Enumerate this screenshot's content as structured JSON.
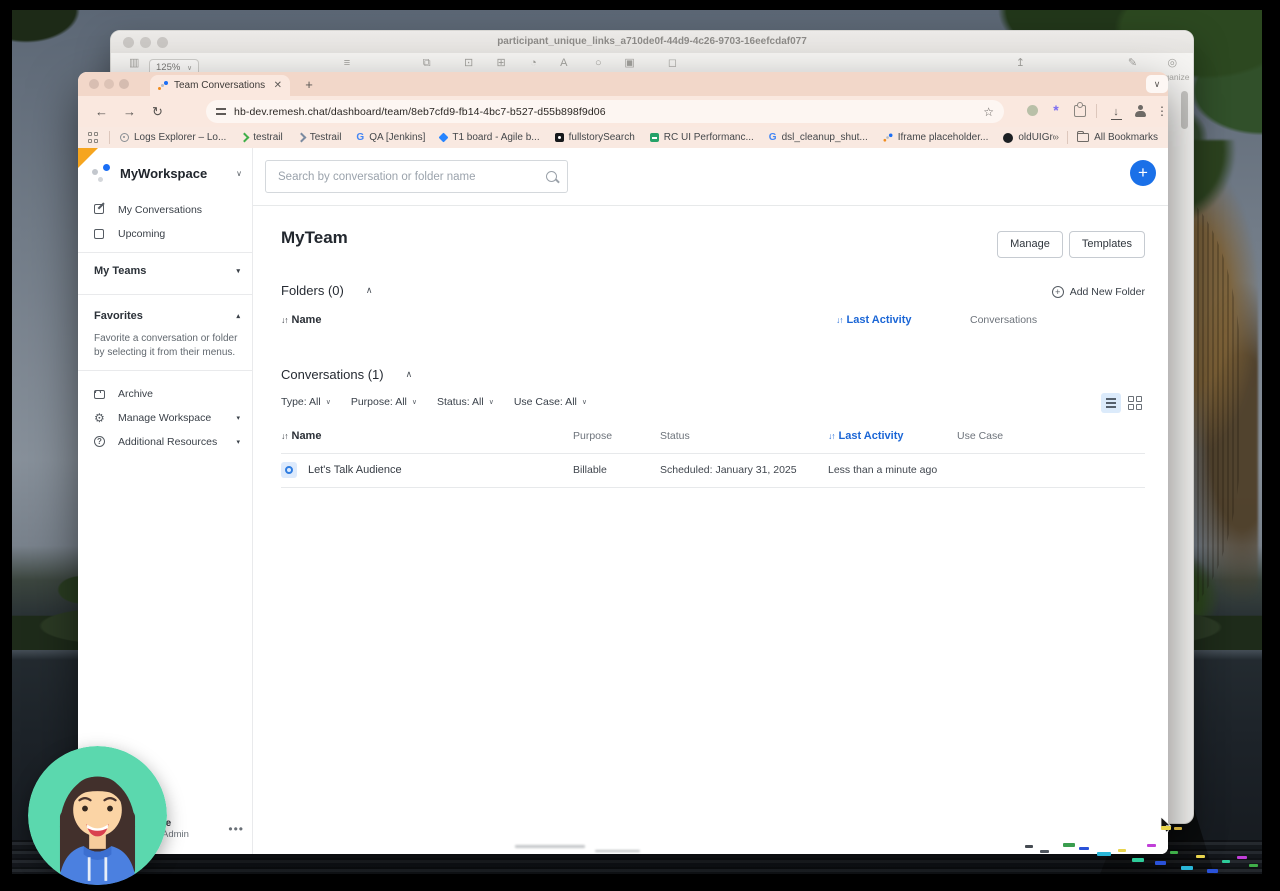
{
  "background_window": {
    "title": "participant_unique_links_a710de0f-44d9-4c26-9703-16eefcdaf077",
    "zoom_value": "125%",
    "toolbar": [
      "View",
      "Zoom",
      "Add Category",
      "Pivot Table",
      "Insert",
      "Table",
      "Chart",
      "Text",
      "Shape",
      "Media",
      "Comment",
      "Share",
      "Format",
      "Organize"
    ]
  },
  "browser": {
    "tab_title": "Team Conversations",
    "url": "hb-dev.remesh.chat/dashboard/team/8eb7cfd9-fb14-4bc7-b527-d55b898f9d06",
    "bookmarks": [
      "Logs Explorer – Lo...",
      "testrail",
      "Testrail",
      "QA [Jenkins]",
      "T1 board - Agile b...",
      "fullstorySearch",
      "RC UI Performanc...",
      "dsl_cleanup_shut...",
      "Iframe placeholder...",
      "oldUIGreen&Black"
    ],
    "all_bookmarks": "All Bookmarks"
  },
  "app": {
    "workspace": "MyWorkspace",
    "nav_my_conversations": "My Conversations",
    "nav_upcoming": "Upcoming",
    "section_my_teams": "My Teams",
    "section_favorites": "Favorites",
    "favorites_hint": "Favorite a conversation or folder by selecting it from their menus.",
    "nav_archive": "Archive",
    "nav_manage_workspace": "Manage Workspace",
    "nav_additional_resources": "Additional Resources",
    "user_name_fragment": "nce",
    "user_role": "Admin",
    "search_placeholder": "Search by conversation or folder name",
    "page_title": "MyTeam",
    "manage_btn": "Manage",
    "templates_btn": "Templates",
    "folders_heading": "Folders (0)",
    "add_new_folder": "Add New Folder",
    "folders_col_name": "Name",
    "folders_col_last_activity": "Last Activity",
    "folders_col_conversations": "Conversations",
    "conversations_heading": "Conversations (1)",
    "filter_type": "Type: All",
    "filter_purpose": "Purpose: All",
    "filter_status": "Status: All",
    "filter_use_case": "Use Case: All",
    "col_name": "Name",
    "col_purpose": "Purpose",
    "col_status": "Status",
    "col_last_activity": "Last Activity",
    "col_use_case": "Use Case",
    "row": {
      "name": "Let's Talk Audience",
      "purpose": "Billable",
      "status": "Scheduled: January 31, 2025",
      "last_activity": "Less than a minute ago"
    },
    "colors": {
      "accent_blue": "#1b66d6",
      "plus_button_blue": "#1a70e8",
      "corner_orange": "#f6a51f",
      "row_badge_blue": "#2f7de1"
    }
  }
}
